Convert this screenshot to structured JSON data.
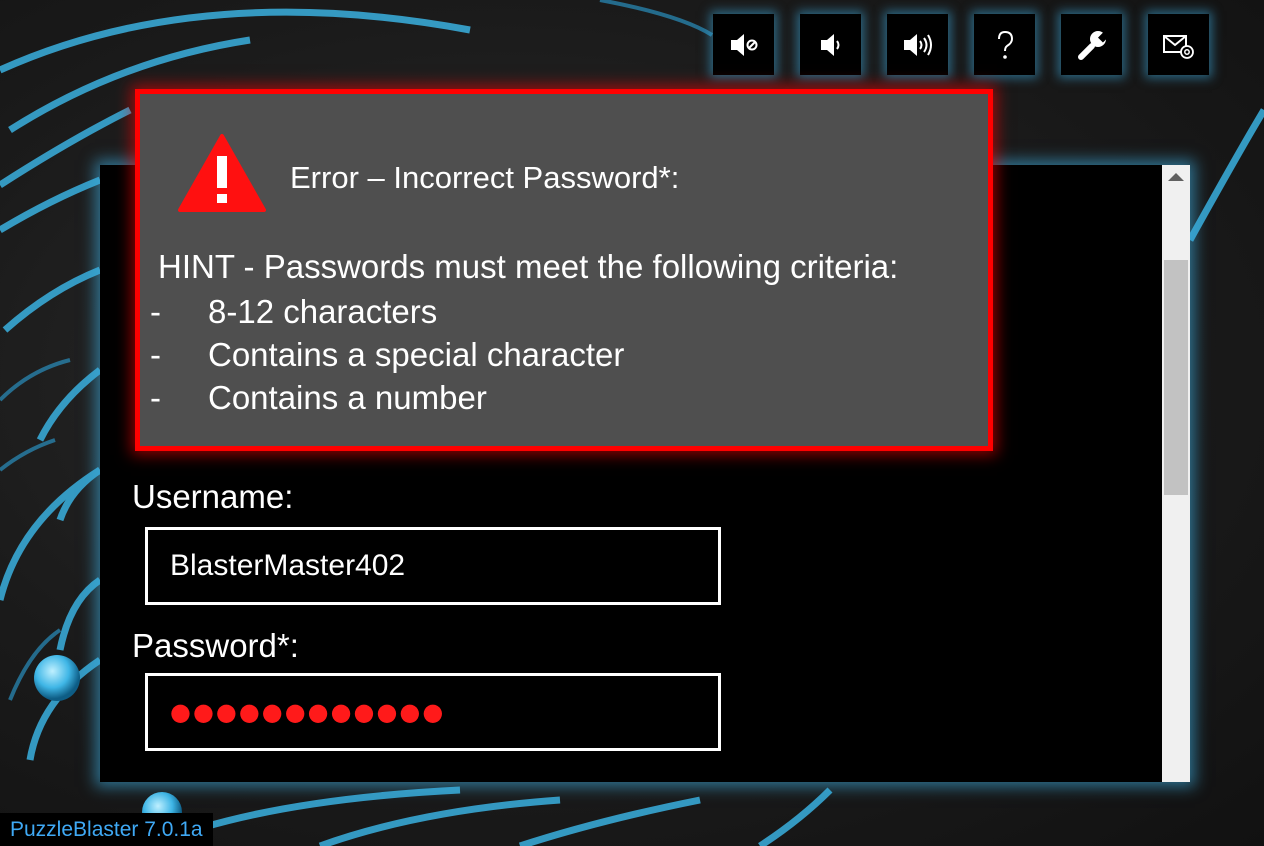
{
  "toolbar": {
    "buttons": [
      {
        "name": "mute",
        "icon": "speaker-mute-icon"
      },
      {
        "name": "volume-low",
        "icon": "speaker-low-icon"
      },
      {
        "name": "volume-high",
        "icon": "speaker-high-icon"
      },
      {
        "name": "help",
        "icon": "question-mark-icon"
      },
      {
        "name": "settings",
        "icon": "wrench-icon"
      },
      {
        "name": "contact",
        "icon": "mail-at-icon"
      }
    ]
  },
  "dialog": {
    "title": "Error – Incorrect Password*:",
    "hint": "HINT - Passwords must meet the following criteria:",
    "criteria": [
      "8-12 characters",
      "Contains a special character",
      "Contains a number"
    ],
    "bullet": "-"
  },
  "form": {
    "username_label": "Username:",
    "username_value": "BlasterMaster402",
    "password_label": "Password*:",
    "password_mask": "●●●●●●●●●●●●"
  },
  "app": {
    "version_label": "PuzzleBlaster 7.0.1a"
  },
  "colors": {
    "accent_glow": "#3caadc",
    "error_red": "#ff0000",
    "dialog_bg": "#4f4f4f",
    "version_text": "#3fa9f5",
    "password_dots": "#ff1a1a"
  }
}
